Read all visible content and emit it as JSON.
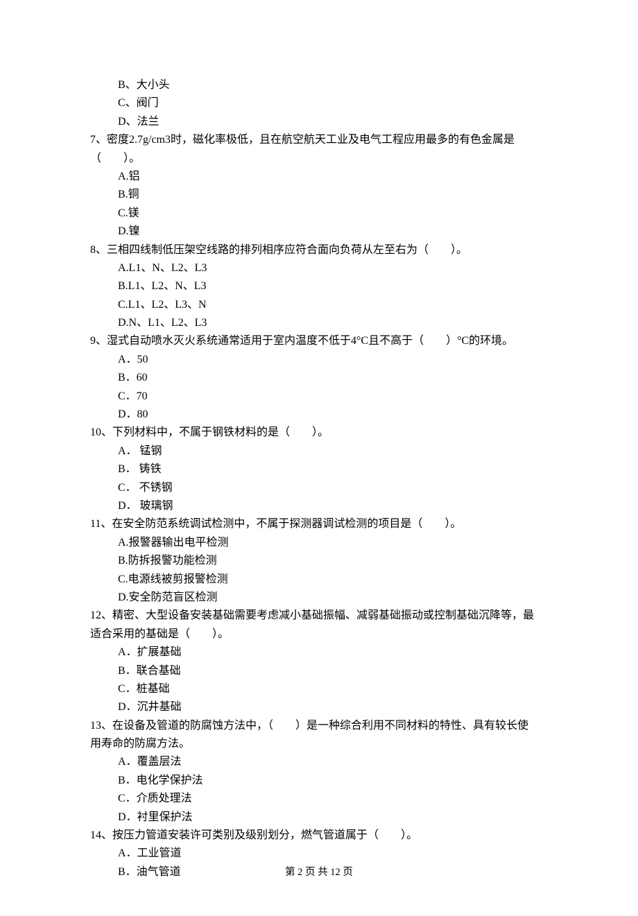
{
  "q6": {
    "optB": "B、大小头",
    "optC": "C、阀门",
    "optD": "D、法兰"
  },
  "q7": {
    "line1": "7、密度2.7g/cm3时，磁化率极低，且在航空航天工业及电气工程应用最多的有色金属是",
    "line2": "（　　）。",
    "optA": "A.铝",
    "optB": "B.铜",
    "optC": "C.镁",
    "optD": "D.镍"
  },
  "q8": {
    "text": "8、三相四线制低压架空线路的排列相序应符合面向负荷从左至右为（　　）。",
    "optA": "A.L1、N、L2、L3",
    "optB": "B.L1、L2、N、L3",
    "optC": "C.L1、L2、L3、N",
    "optD": "D.N、L1、L2、L3"
  },
  "q9": {
    "text": "9、湿式自动喷水灭火系统通常适用于室内温度不低于4°C且不高于（　　）°C的环境。",
    "optA": "A．50",
    "optB": "B．60",
    "optC": "C．70",
    "optD": "D．80"
  },
  "q10": {
    "text": "10、下列材料中，不属于钢铁材料的是（　　）。",
    "optA": "A． 锰钢",
    "optB": "B． 铸铁",
    "optC": "C． 不锈钢",
    "optD": "D． 玻璃钢"
  },
  "q11": {
    "text": "11、在安全防范系统调试检测中，不属于探测器调试检测的项目是（　　）。",
    "optA": "A.报警器输出电平检测",
    "optB": "B.防拆报警功能检测",
    "optC": "C.电源线被剪报警检测",
    "optD": "D.安全防范盲区检测"
  },
  "q12": {
    "line1": "12、精密、大型设备安装基础需要考虑减小基础振幅、减弱基础振动或控制基础沉降等，最",
    "line2": "适合采用的基础是（　　）。",
    "optA": "A．扩展基础",
    "optB": "B．联合基础",
    "optC": "C．桩基础",
    "optD": "D．沉井基础"
  },
  "q13": {
    "line1": "13、在设备及管道的防腐蚀方法中，（　　）是一种综合利用不同材料的特性、具有较长使",
    "line2": "用寿命的防腐方法。",
    "optA": "A．覆盖层法",
    "optB": "B．电化学保护法",
    "optC": "C．介质处理法",
    "optD": "D．衬里保护法"
  },
  "q14": {
    "text": "14、按压力管道安装许可类别及级别划分，燃气管道属于（　　）。",
    "optA": "A．工业管道",
    "optB": "B．油气管道"
  },
  "footer": "第 2 页 共 12 页"
}
